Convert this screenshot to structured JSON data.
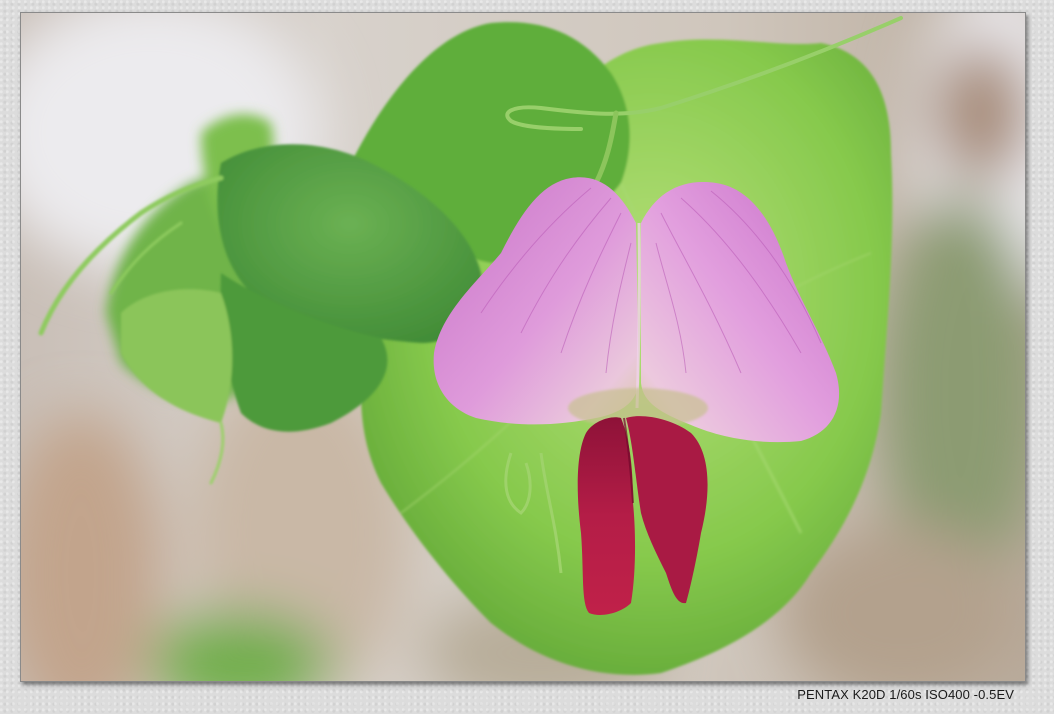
{
  "photo": {
    "subject": "pink-pea-flower-icon"
  },
  "caption": {
    "camera_info": "PENTAX K20D 1/60s ISO400 -0.5EV"
  },
  "colors": {
    "page_background": "#dcdcdc",
    "petal_pink": "#d47fd0",
    "keel_crimson": "#a8183f",
    "leaf_green": "#7fc54a"
  }
}
